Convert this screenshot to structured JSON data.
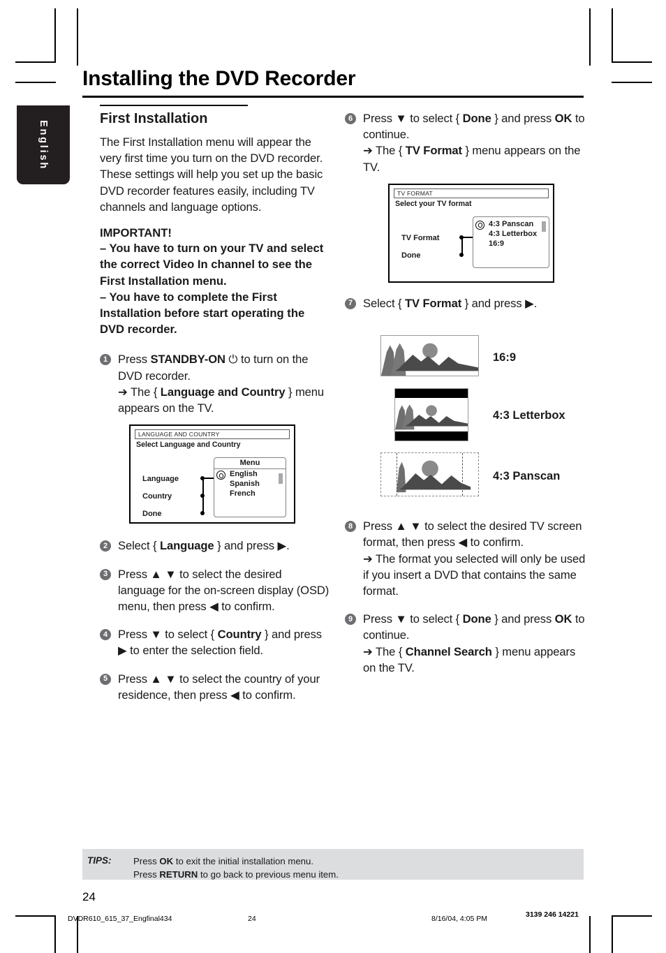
{
  "document": {
    "title": "Installing the DVD Recorder",
    "language_tab": "English",
    "page_number": "24"
  },
  "left_column": {
    "section_title": "First Installation",
    "intro": "The First Installation menu will appear the very first time you turn on the DVD recorder.  These settings will help you set up the basic DVD recorder features easily, including TV channels and language options.",
    "important_heading": "IMPORTANT!",
    "important_items": [
      "–  You have to turn on your TV and select the correct Video In channel to see the First Installation menu.",
      "–  You have to complete the First Installation before start operating the DVD recorder."
    ],
    "steps": [
      {
        "number": "1",
        "line1_pre": "Press ",
        "line1_bold": "STANDBY-ON",
        "line1_post": " ⏻ to turn on the DVD recorder.",
        "result_pre": "➔ The { ",
        "result_bold": "Language and Country",
        "result_post": " } menu appears on the TV."
      },
      {
        "number": "2",
        "line1_pre": "Select { ",
        "line1_bold": "Language",
        "line1_post": " } and press ▶."
      },
      {
        "number": "3",
        "line1_pre": "Press ▲ ▼ to select the desired language for the on-screen display (OSD) menu, then press ◀ to confirm."
      },
      {
        "number": "4",
        "line1_pre": "Press ▼ to select { ",
        "line1_bold": "Country",
        "line1_post": " } and press ▶  to enter the selection field."
      },
      {
        "number": "5",
        "line1_pre": "Press ▲ ▼ to select the country of your residence, then press ◀ to confirm."
      }
    ],
    "osd": {
      "title": "LANGUAGE AND COUNTRY",
      "subtitle": "Select Language and Country",
      "labels": [
        "Language",
        "Country",
        "Done"
      ],
      "panel_title": "Menu",
      "panel_items": [
        "English",
        "Spanish",
        "French"
      ],
      "selected_item": "English"
    }
  },
  "right_column": {
    "steps": [
      {
        "number": "6",
        "line1_pre": "Press ▼ to select { ",
        "line1_bold": "Done",
        "line1_post": " } and press ",
        "line1_bold2": "OK",
        "line1_post2": " to continue.",
        "result_pre": "➔ The { ",
        "result_bold": "TV Format",
        "result_post": " } menu appears on the TV."
      },
      {
        "number": "7",
        "line1_pre": "Select { ",
        "line1_bold": "TV Format",
        "line1_post": " } and press ▶."
      },
      {
        "number": "8",
        "line1_pre": "Press ▲ ▼ to select the desired TV screen format, then press ◀ to confirm.",
        "result_pre": "➔ The format you selected will only be used if you insert a DVD that contains the same format."
      },
      {
        "number": "9",
        "line1_pre": "Press ▼ to select { ",
        "line1_bold": "Done",
        "line1_post": " } and press ",
        "line1_bold2": "OK",
        "line1_post2": " to continue.",
        "result_pre": "➔ The { ",
        "result_bold": "Channel Search",
        "result_post": " } menu appears on the TV."
      }
    ],
    "osd": {
      "title": "TV FORMAT",
      "subtitle": "Select your TV format",
      "labels": [
        "TV Format",
        "Done"
      ],
      "panel_items": [
        "4:3 Panscan",
        "4:3 Letterbox",
        "16:9"
      ],
      "selected_item": "4:3 Panscan"
    },
    "formats": [
      {
        "label": "16:9",
        "kind": "widescreen"
      },
      {
        "label": "4:3  Letterbox",
        "kind": "letterbox"
      },
      {
        "label": "4:3 Panscan",
        "kind": "panscan"
      }
    ]
  },
  "tips": {
    "label": "TIPS:",
    "lines": [
      {
        "pre": "Press ",
        "bold": "OK",
        "post": " to exit the initial installation menu."
      },
      {
        "pre": "Press ",
        "bold": "RETURN",
        "post": " to go back to previous menu item."
      }
    ]
  },
  "printer_footer": {
    "filename": "DVDR610_615_37_Engfinal434",
    "page": "24",
    "timestamp": "8/16/04, 4:05 PM",
    "doc_code": "3139 246 14221"
  },
  "colors": {
    "step_bullet": "#6d6e71",
    "tips_background": "#dcdddf",
    "tab_background": "#231f20",
    "sun": "#8a8a8a"
  }
}
